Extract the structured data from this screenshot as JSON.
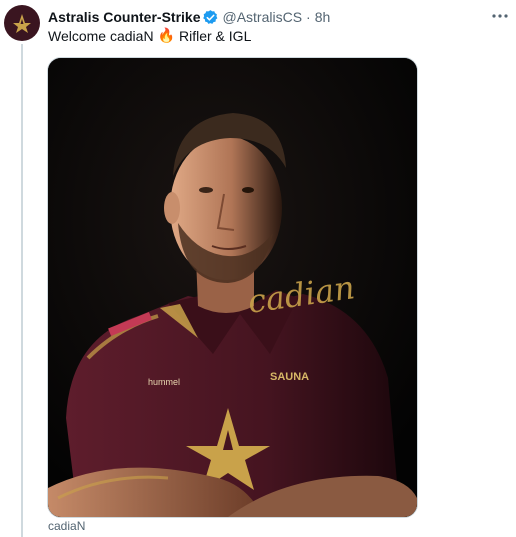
{
  "tweet": {
    "author": {
      "display_name": "Astralis Counter-Strike",
      "handle": "@AstralisCS",
      "verified": true
    },
    "separator": "·",
    "time": "8h",
    "text_before": "Welcome cadiaN",
    "emoji": "🔥",
    "text_after": "Rifler & IGL",
    "media": {
      "signature": "cadian",
      "shirt_sponsor": "SAUNA",
      "kit_brand": "hummel"
    },
    "caption": "cadiaN"
  },
  "colors": {
    "brand_maroon": "#5a1b2a",
    "gold": "#c9a24a",
    "verified_blue": "#1d9bf0",
    "muted_text": "#536471"
  },
  "icons": {
    "avatar": "astralis-star-logo",
    "verified": "verified-badge-icon",
    "more": "more-horizontal-icon"
  }
}
